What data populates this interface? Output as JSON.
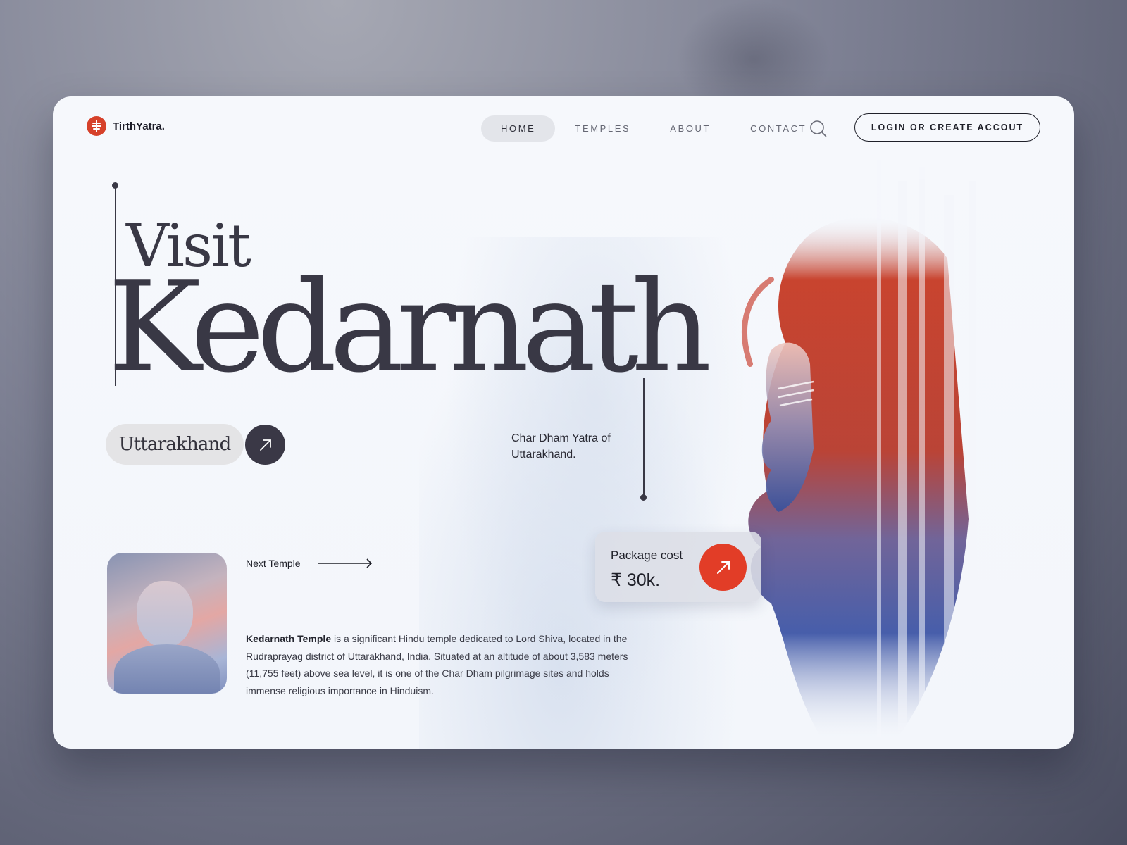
{
  "brand": {
    "name": "TirthYatra.",
    "logo_icon": "temple-icon",
    "accent": "#d6412a"
  },
  "nav": {
    "items": [
      {
        "label": "HOME",
        "active": true
      },
      {
        "label": "TEMPLES",
        "active": false
      },
      {
        "label": "ABOUT",
        "active": false
      },
      {
        "label": "CONTACT",
        "active": false
      }
    ],
    "search_icon": "search-icon",
    "login_label": "LOGIN OR CREATE ACCOUT"
  },
  "hero": {
    "visit": "Visit",
    "title": "Kedarnath",
    "region": "Uttarakhand",
    "tagline": "Char Dham Yatra of Uttarakhand."
  },
  "package": {
    "label": "Package cost",
    "value": "₹ 30k.",
    "button_color": "#e23d27"
  },
  "next_temple": {
    "label": "Next Temple"
  },
  "description": {
    "bold": "Kedarnath Temple",
    "text": " is a significant Hindu temple dedicated to Lord Shiva, located in the Rudraprayag district of Uttarakhand, India. Situated at an altitude of about 3,583 meters (11,755 feet) above sea level, it is one of the Char Dham pilgrimage sites and holds immense religious importance in Hinduism."
  }
}
